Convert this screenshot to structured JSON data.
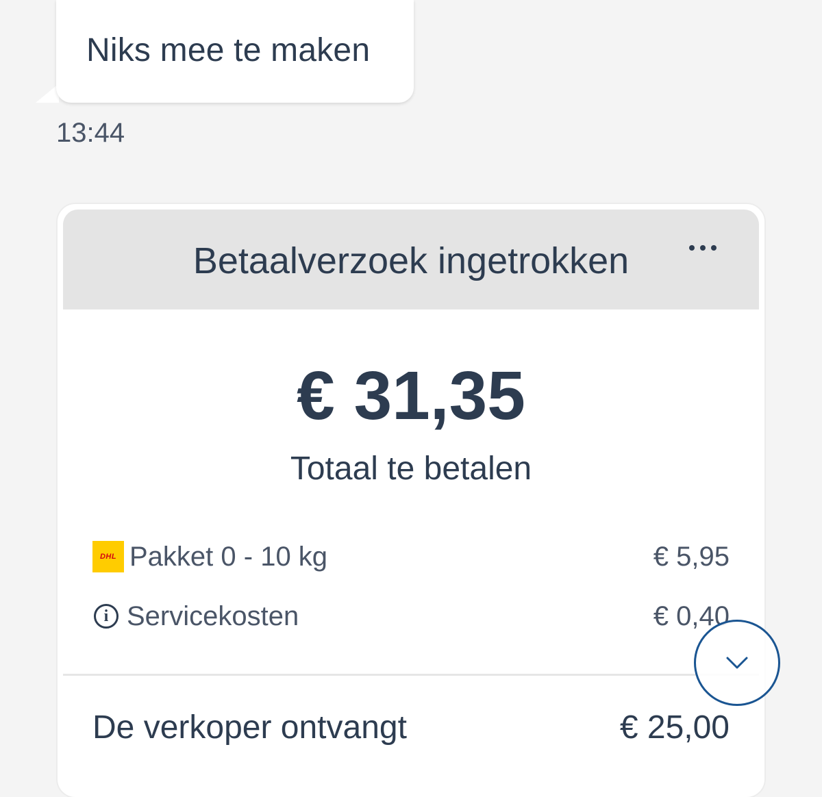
{
  "message": {
    "text": "Niks mee te maken",
    "time": "13:44"
  },
  "payment_card": {
    "title": "Betaalverzoek ingetrokken",
    "amount": "€ 31,35",
    "amount_label": "Totaal te betalen",
    "lines": [
      {
        "icon": "dhl-logo-icon",
        "label": "Pakket 0 - 10 kg",
        "value": "€ 5,95"
      },
      {
        "icon": "info-icon",
        "label": "Servicekosten",
        "value": "€ 0,40"
      }
    ],
    "seller_label": "De verkoper ontvangt",
    "seller_amount": "€ 25,00"
  },
  "icons": {
    "dhl_text": "DHL"
  },
  "colors": {
    "text": "#2d3c50",
    "header_bg": "#e4e4e4",
    "accent": "#1a5592",
    "dhl_yellow": "#ffcc00",
    "dhl_red": "#d40511"
  }
}
